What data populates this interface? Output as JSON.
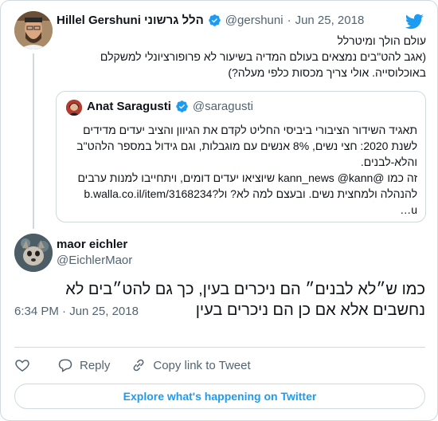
{
  "parent_tweet": {
    "author_name": "Hillel Gershuni הלל גרשוני",
    "handle": "@gershuni",
    "date": "Jun 25, 2018",
    "text_lines": [
      "עולם הולך ומיטרלל",
      "(אגב להט\"בים נמצאים בעולם המדיה בשיעור לא פרופורציונלי למשקלם",
      "באוכלוסייה. אולי צריך מכסות כלפי מעלה?)"
    ],
    "quoted": {
      "author_name": "Anat Saragusti",
      "handle": "@saragusti",
      "text_lines": [
        "תאגיד השידור הציבורי ביביסי החליט לקדם את הגיוון והציב יעדים מדידים",
        "לשנת 2020: חצי נשים, 8% אנשים עם מוגבלות, וגם גידול במספר הלהט\"ב",
        "והלא-לבנים.",
        "זה כמו @kann_news @kann שיוציאו יעדים דומים, ויתחייבו למנות ערבים",
        "להנהלה ולמחצית נשים. ובעצם למה לא? ול?b.walla.co.il/item/3168234",
        "u…"
      ]
    }
  },
  "main_tweet": {
    "author_name": "maor eichler",
    "handle": "@EichlerMaor",
    "text": "כמו ש״לא לבנים״ הם ניכרים בעין, כך גם להט״בים לא נחשבים אלא אם כן הם ניכרים בעין",
    "time": "6:34 PM · Jun 25, 2018"
  },
  "actions": {
    "like_icon": "heart-icon",
    "reply_label": "Reply",
    "copy_link_label": "Copy link to Tweet"
  },
  "explore_label": "Explore what's happening on Twitter",
  "colors": {
    "accent": "#1d9bf0",
    "muted_text": "#536471",
    "border": "#cfd9de"
  }
}
